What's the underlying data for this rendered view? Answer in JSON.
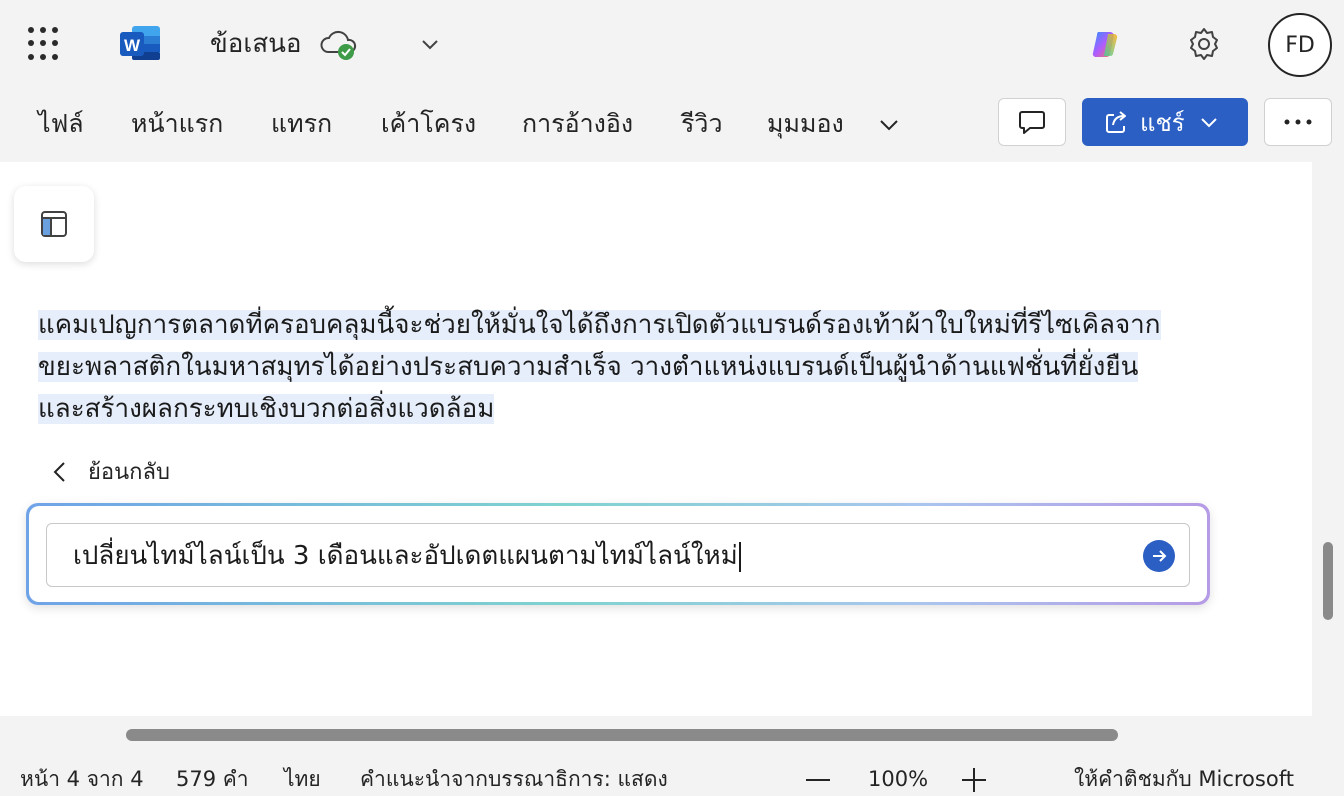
{
  "titlebar": {
    "app_launcher_icon": "waffle-icon",
    "app_logo": "word-logo",
    "app_logo_letter": "W",
    "document_title": "ข้อเสนอ",
    "save_status_icon": "cloud-saved-icon",
    "copilot_icon": "copilot-icon",
    "settings_icon": "gear-icon",
    "avatar_initials": "FD"
  },
  "ribbon": {
    "tabs": [
      {
        "label": "ไฟล์"
      },
      {
        "label": "หน้าแรก"
      },
      {
        "label": "แทรก"
      },
      {
        "label": "เค้าโครง"
      },
      {
        "label": "การอ้างอิง"
      },
      {
        "label": "รีวิว"
      },
      {
        "label": "มุมมอง"
      }
    ],
    "comment_icon": "comment-icon",
    "share_label": "แชร์",
    "more_icon": "more-icon",
    "accent_color": "#2b5fc4"
  },
  "document": {
    "paragraph_lines": [
      "แคมเปญการตลาดที่ครอบคลุมนี้จะช่วยให้มั่นใจได้ถึงการเปิดตัวแบรนด์รองเท้าผ้าใบใหม่ที่รีไซเคิลจาก",
      "ขยะพลาสติกในมหาสมุทรได้อย่างประสบความสำเร็จ วางตำแหน่งแบรนด์เป็นผู้นำด้านแฟชั่นที่ยั่งยืน",
      "และสร้างผลกระทบเชิงบวกต่อสิ่งแวดล้อม"
    ],
    "highlight_color": "#e6eefb"
  },
  "copilot_prompt": {
    "back_label": "ย้อนกลับ",
    "input_value": "เปลี่ยนไทม์ไลน์เป็น 3 เดือนและอัปเดตแผนตามไทม์ไลน์ใหม่",
    "send_icon": "send-arrow-icon"
  },
  "statusbar": {
    "page_info": "หน้า 4 จาก 4",
    "word_count": "579 คำ",
    "language": "ไทย",
    "editor_suggestions": "คำแนะนำจากบรรณาธิการ: แสดง",
    "zoom_level": "100%",
    "feedback": "ให้คำติชมกับ Microsoft"
  }
}
